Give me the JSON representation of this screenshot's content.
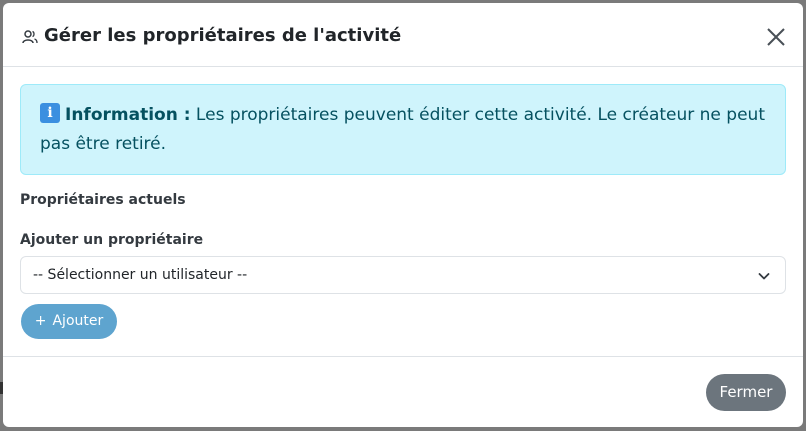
{
  "modal": {
    "title": "Gérer les propriétaires de l'activité",
    "header_icon": "users-icon",
    "close_icon": "close-icon"
  },
  "alert": {
    "icon": "info-icon",
    "strong": "Information :",
    "message": " Les propriétaires peuvent éditer cette activité. Le créateur ne peut pas être retiré."
  },
  "current_owners": {
    "label": "Propriétaires actuels"
  },
  "add_owner": {
    "label": "Ajouter un propriétaire",
    "select_value": "-- Sélectionner un utilisateur --",
    "button_label": "Ajouter",
    "button_icon": "plus-icon"
  },
  "footer": {
    "close_label": "Fermer"
  },
  "colors": {
    "alert_bg": "#cff4fc",
    "alert_text": "#055160",
    "add_button": "#5ea4cf",
    "close_button": "#6c757d"
  }
}
